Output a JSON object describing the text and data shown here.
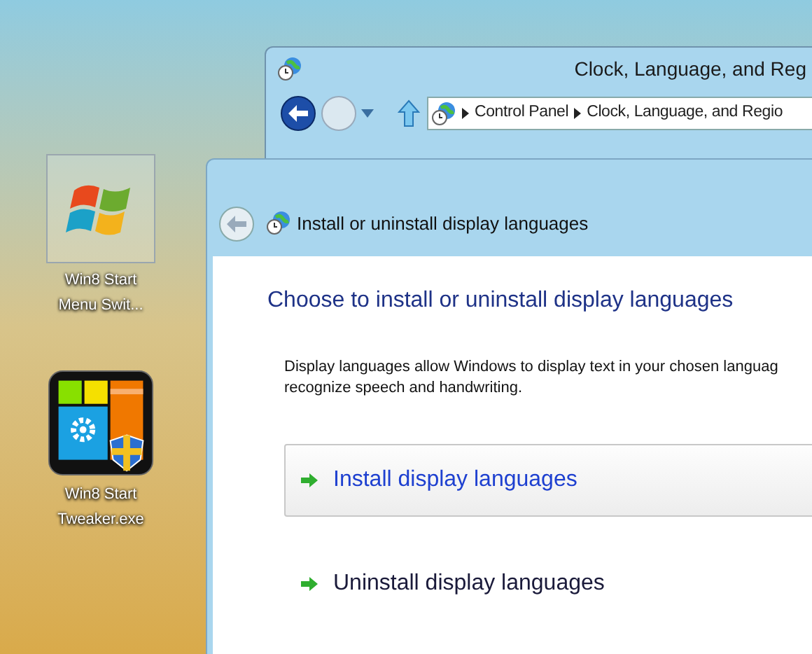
{
  "desktop_icons": [
    {
      "kind": "windows-logo",
      "selected": true,
      "lines": [
        "Win8 Start",
        "Menu Swit..."
      ]
    },
    {
      "kind": "tweaker",
      "selected": false,
      "lines": [
        "Win8 Start",
        "Tweaker.exe"
      ]
    }
  ],
  "back_window": {
    "title": "Clock, Language, and Reg",
    "breadcrumb": [
      "Control Panel",
      "Clock, Language, and Regio"
    ]
  },
  "dialog": {
    "title": "Install or uninstall display languages",
    "heading": "Choose to install or uninstall display languages",
    "description": [
      "Display languages allow Windows to display text in your chosen languag",
      "recognize speech and handwriting."
    ],
    "options": [
      {
        "label": "Install display languages",
        "selected": true
      },
      {
        "label": "Uninstall display languages",
        "selected": false
      }
    ]
  }
}
